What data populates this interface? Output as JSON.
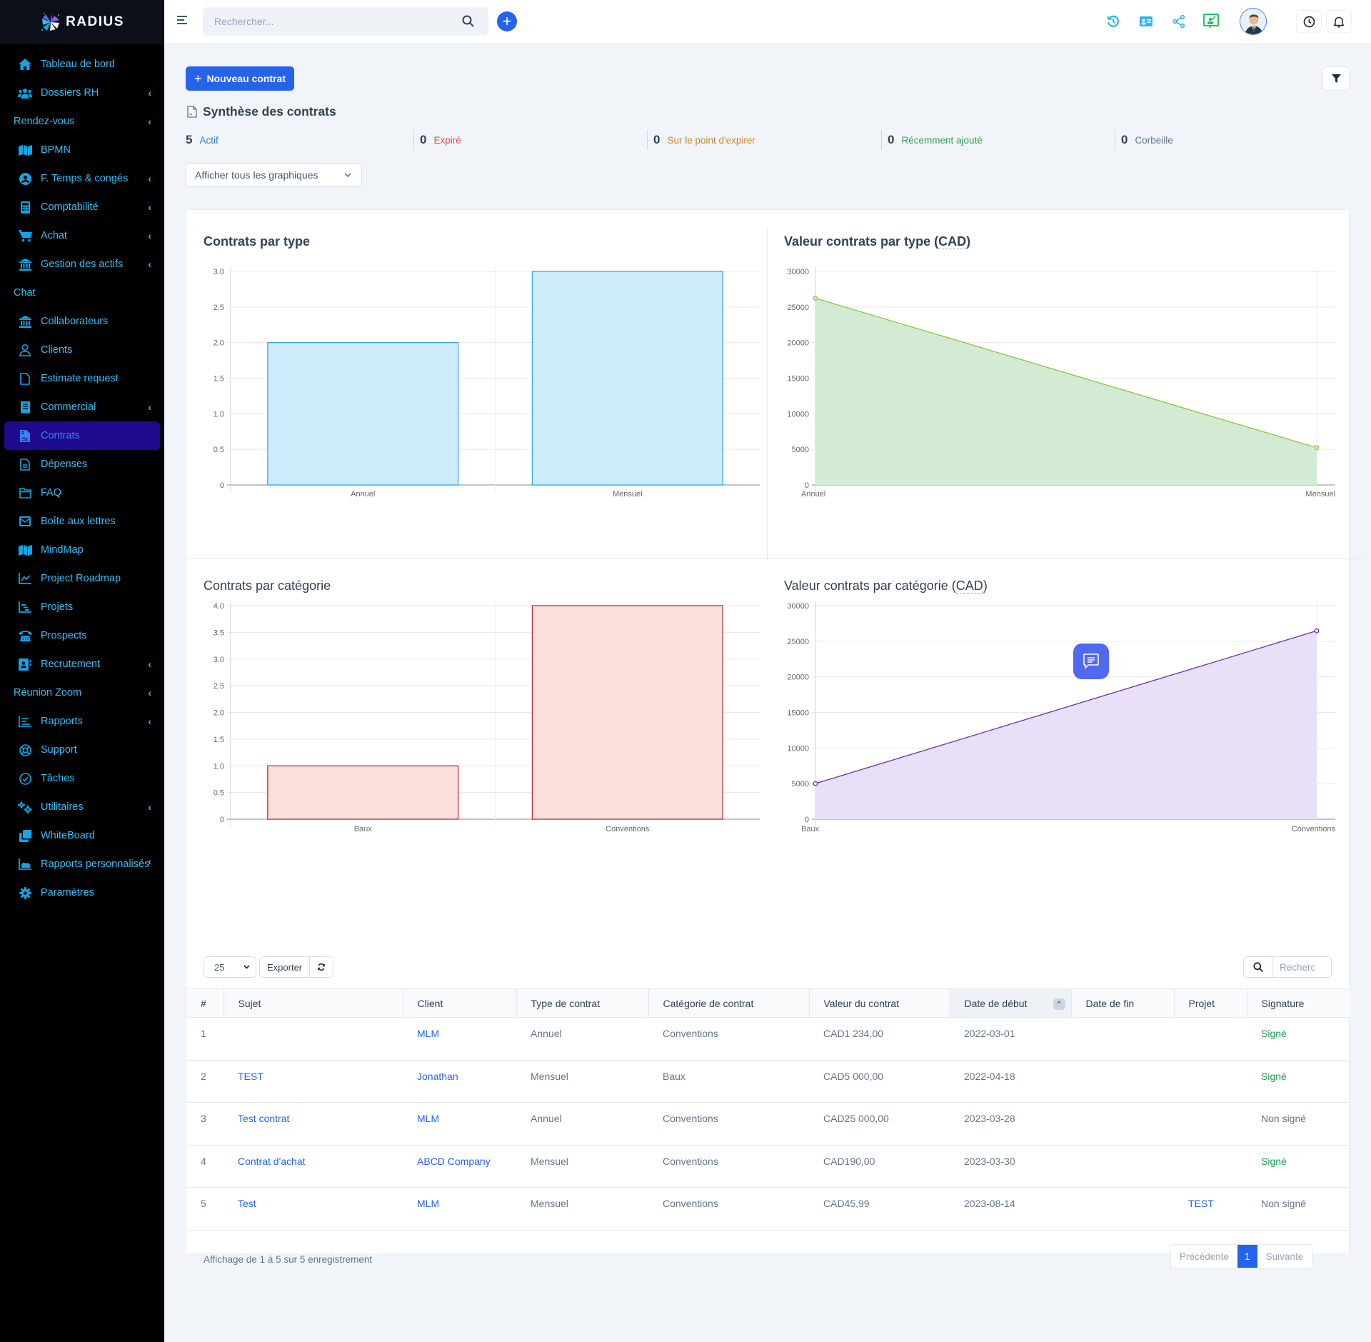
{
  "brand": {
    "name": "RADIUS"
  },
  "sidebar": {
    "items": [
      {
        "label": "Tableau de bord",
        "icon": "home-icon",
        "chevron": false,
        "active": false
      },
      {
        "label": "Dossiers RH",
        "icon": "users-icon",
        "chevron": true,
        "active": false
      },
      {
        "label": "Rendez-vous",
        "icon": null,
        "chevron": true,
        "active": false
      },
      {
        "label": "BPMN",
        "icon": "map-icon",
        "chevron": false,
        "active": false
      },
      {
        "label": "F. Temps & congés",
        "icon": "user-circle-icon",
        "chevron": true,
        "active": false
      },
      {
        "label": "Comptabilité",
        "icon": "calculator-icon",
        "chevron": true,
        "active": false
      },
      {
        "label": "Achat",
        "icon": "cart-icon",
        "chevron": true,
        "active": false
      },
      {
        "label": "Gestion des actifs",
        "icon": "bank-icon",
        "chevron": true,
        "active": false
      },
      {
        "label": "Chat",
        "icon": null,
        "chevron": false,
        "active": false
      },
      {
        "label": "Collaborateurs",
        "icon": "bank-icon",
        "chevron": false,
        "active": false
      },
      {
        "label": "Clients",
        "icon": "user-icon",
        "chevron": false,
        "active": false
      },
      {
        "label": "Estimate request",
        "icon": "file-icon",
        "chevron": false,
        "active": false
      },
      {
        "label": "Commercial",
        "icon": "receipt-icon",
        "chevron": true,
        "active": false
      },
      {
        "label": "Contrats",
        "icon": "contract-icon",
        "chevron": false,
        "active": true
      },
      {
        "label": "Dépenses",
        "icon": "file-text-icon",
        "chevron": false,
        "active": false
      },
      {
        "label": "FAQ",
        "icon": "folder-icon",
        "chevron": false,
        "active": false
      },
      {
        "label": "Boîte aux lettres",
        "icon": "mail-icon",
        "chevron": false,
        "active": false
      },
      {
        "label": "MindMap",
        "icon": "map-icon",
        "chevron": false,
        "active": false
      },
      {
        "label": "Project Roadmap",
        "icon": "line-chart-icon",
        "chevron": false,
        "active": false
      },
      {
        "label": "Projets",
        "icon": "gantt-icon",
        "chevron": false,
        "active": false
      },
      {
        "label": "Prospects",
        "icon": "phone-icon",
        "chevron": false,
        "active": false
      },
      {
        "label": "Recrutement",
        "icon": "id-card-icon",
        "chevron": true,
        "active": false
      },
      {
        "label": "Réunion Zoom",
        "icon": null,
        "chevron": true,
        "active": false
      },
      {
        "label": "Rapports",
        "icon": "report-icon",
        "chevron": true,
        "active": false
      },
      {
        "label": "Support",
        "icon": "lifebuoy-icon",
        "chevron": false,
        "active": false
      },
      {
        "label": "Tâches",
        "icon": "check-circle-icon",
        "chevron": false,
        "active": false
      },
      {
        "label": "Utilitaires",
        "icon": "gears-icon",
        "chevron": true,
        "active": false
      },
      {
        "label": "WhiteBoard",
        "icon": "clone-icon",
        "chevron": false,
        "active": false
      },
      {
        "label": "Rapports personnalisés",
        "icon": "area-chart-icon",
        "chevron": true,
        "active": false
      },
      {
        "label": "Paramètres",
        "icon": "gear-icon",
        "chevron": false,
        "active": false
      }
    ]
  },
  "topbar": {
    "search_placeholder": "Rechercher...",
    "icons": [
      "history-icon",
      "contact-card-icon",
      "share-icon",
      "presentation-icon"
    ],
    "avatar_alt": "Profil utilisateur"
  },
  "actions": {
    "new_contract": "Nouveau contrat"
  },
  "summary": {
    "title": "Synthèse des contrats",
    "stats": [
      {
        "count": "5",
        "label": "Actif",
        "color": "#2b7fc4"
      },
      {
        "count": "0",
        "label": "Expiré",
        "color": "#e04848"
      },
      {
        "count": "0",
        "label": "Sur le point d'expirer",
        "color": "#c8862a"
      },
      {
        "count": "0",
        "label": "Récemment ajouté",
        "color": "#2f9e54"
      },
      {
        "count": "0",
        "label": "Corbeille",
        "color": "#64748b"
      }
    ]
  },
  "chart_filter": {
    "selected": "Afficher tous les graphiques"
  },
  "chart_data": [
    {
      "id": "contracts-by-type",
      "type": "bar",
      "title": "Contrats par type",
      "title_abbr": "",
      "categories": [
        "Annuel",
        "Mensuel"
      ],
      "values": [
        2,
        3
      ],
      "ylim": [
        0,
        3
      ],
      "yticks": [
        0,
        0.5,
        1,
        1.5,
        2,
        2.5,
        3
      ],
      "ytick_labels": [
        "0",
        "0.5",
        "1.0",
        "1.5",
        "2.0",
        "2.5",
        "3.0"
      ],
      "grid": true,
      "fill": "#cdebfb",
      "stroke": "#29a7d8"
    },
    {
      "id": "value-by-type",
      "type": "area",
      "title": "Valeur contrats par type (",
      "title_abbr": "CAD",
      "title_suffix": ")",
      "categories": [
        "Annuel",
        "Mensuel"
      ],
      "values": [
        26234,
        5236
      ],
      "ylim": [
        0,
        30000
      ],
      "yticks": [
        0,
        5000,
        10000,
        15000,
        20000,
        25000,
        30000
      ],
      "ytick_labels": [
        "0",
        "5000",
        "10000",
        "15000",
        "20000",
        "25000",
        "30000"
      ],
      "grid": true,
      "fill": "#d3ead3",
      "stroke": "#8cc63f"
    },
    {
      "id": "contracts-by-category",
      "type": "bar",
      "title": "Contrats par catégorie",
      "title_abbr": "",
      "categories": [
        "Baux",
        "Conventions"
      ],
      "values": [
        1,
        4
      ],
      "ylim": [
        0,
        4
      ],
      "yticks": [
        0,
        0.5,
        1,
        1.5,
        2,
        2.5,
        3,
        3.5,
        4
      ],
      "ytick_labels": [
        "0",
        "0.5",
        "1.0",
        "1.5",
        "2.0",
        "2.5",
        "3.0",
        "3.5",
        "4.0"
      ],
      "grid": true,
      "fill": "#fde0dc",
      "stroke": "#b0242a"
    },
    {
      "id": "value-by-category",
      "type": "area",
      "title": "Valeur contrats par catégorie (",
      "title_abbr": "CAD",
      "title_suffix": ")",
      "categories": [
        "Baux",
        "Conventions"
      ],
      "values": [
        5000,
        26470
      ],
      "ylim": [
        0,
        30000
      ],
      "yticks": [
        0,
        5000,
        10000,
        15000,
        20000,
        25000,
        30000
      ],
      "ytick_labels": [
        "0",
        "5000",
        "10000",
        "15000",
        "20000",
        "25000",
        "30000"
      ],
      "grid": true,
      "fill": "#e7e0f7",
      "stroke": "#6b2fa8"
    }
  ],
  "table": {
    "page_length": "25",
    "export_label": "Exporter",
    "search_placeholder": "Recherc",
    "columns": [
      "#",
      "Sujet",
      "Client",
      "Type de contrat",
      "Catégorie de contrat",
      "Valeur du contrat",
      "Date de début",
      "Date de fin",
      "Projet",
      "Signature"
    ],
    "sorted_column": "Date de début",
    "rows": [
      {
        "num": "1",
        "subject": "",
        "client": "MLM",
        "type": "Annuel",
        "category": "Conventions",
        "value": "CAD1 234,00",
        "start": "2022-03-01",
        "end": "",
        "project": "",
        "signature": "Signé",
        "signed": true
      },
      {
        "num": "2",
        "subject": "TEST",
        "client": "Jonathan",
        "type": "Mensuel",
        "category": "Baux",
        "value": "CAD5 000,00",
        "start": "2022-04-18",
        "end": "",
        "project": "",
        "signature": "Signé",
        "signed": true
      },
      {
        "num": "3",
        "subject": "Test contrat",
        "client": "MLM",
        "type": "Annuel",
        "category": "Conventions",
        "value": "CAD25 000,00",
        "start": "2023-03-28",
        "end": "",
        "project": "",
        "signature": "Non signé",
        "signed": false
      },
      {
        "num": "4",
        "subject": "Contrat d'achat",
        "client": "ABCD Company",
        "type": "Mensuel",
        "category": "Conventions",
        "value": "CAD190,00",
        "start": "2023-03-30",
        "end": "",
        "project": "",
        "signature": "Signé",
        "signed": true
      },
      {
        "num": "5",
        "subject": "Test",
        "client": "MLM",
        "type": "Mensuel",
        "category": "Conventions",
        "value": "CAD45,99",
        "start": "2023-08-14",
        "end": "",
        "project": "TEST",
        "signature": "Non signé",
        "signed": false
      }
    ],
    "info": "Affichage de 1 à 5 sur 5 enregistrement",
    "pagination": {
      "prev": "Précédente",
      "current": "1",
      "next": "Suivante"
    }
  }
}
